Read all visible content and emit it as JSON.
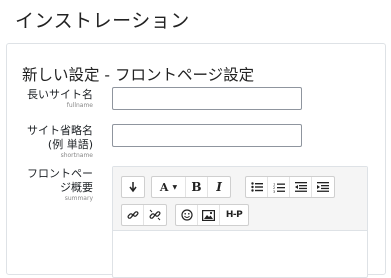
{
  "page": {
    "title": "インストレーション"
  },
  "form": {
    "section_title": "新しい設定 - フロントページ設定",
    "fields": [
      {
        "label": "長いサイト名",
        "id_label": "fullname",
        "value": ""
      },
      {
        "label": "サイト省略名\n(例 単語)",
        "id_label": "shortname",
        "value": ""
      },
      {
        "label": "フロントペー\nジ概要",
        "id_label": "summary"
      }
    ]
  },
  "editor": {
    "toolbar_row1": [
      {
        "icon": "collapse-icon",
        "label": ""
      },
      {
        "icon": "font-size-icon",
        "label": "A"
      },
      {
        "icon": "bold-icon",
        "label": "B"
      },
      {
        "icon": "italic-icon",
        "label": "I"
      },
      {
        "icon": "unordered-list-icon",
        "label": ""
      },
      {
        "icon": "ordered-list-icon",
        "label": ""
      },
      {
        "icon": "outdent-icon",
        "label": ""
      },
      {
        "icon": "indent-icon",
        "label": ""
      }
    ],
    "toolbar_row2": [
      {
        "icon": "link-icon",
        "label": ""
      },
      {
        "icon": "unlink-icon",
        "label": ""
      },
      {
        "icon": "emoji-icon",
        "label": ""
      },
      {
        "icon": "image-icon",
        "label": ""
      },
      {
        "icon": "h5p-icon",
        "label": "H-P"
      }
    ]
  },
  "colors": {
    "border": "#dee2e6",
    "input_border": "#8f959e",
    "toolbar_bg": "#f5f5f5"
  }
}
